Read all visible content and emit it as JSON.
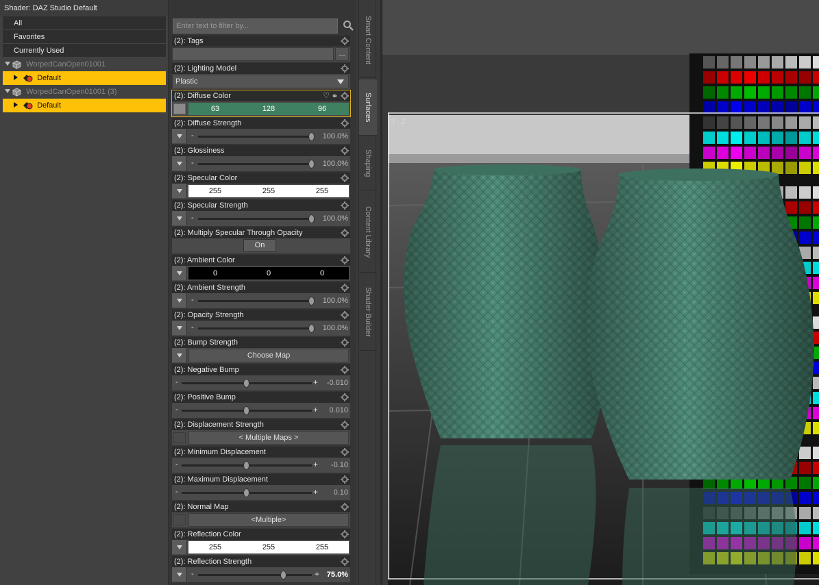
{
  "shader_panel": {
    "title": "Shader: DAZ Studio Default",
    "categories": [
      "All",
      "Favorites",
      "Currently Used"
    ],
    "tree": [
      {
        "label": "WorpedCanOpen01001",
        "child": "Default"
      },
      {
        "label": "WorpedCanOpen01001 (3)",
        "child": "Default"
      }
    ]
  },
  "filter": {
    "placeholder": "Enter text to filter by..."
  },
  "properties": {
    "tags": {
      "label": "(2): Tags",
      "button": "..."
    },
    "lighting_model": {
      "label": "(2): Lighting Model",
      "value": "Plastic"
    },
    "diffuse_color": {
      "label": "(2): Diffuse Color",
      "r": "63",
      "g": "128",
      "b": "96",
      "color": "#3f8060"
    },
    "diffuse_strength": {
      "label": "(2): Diffuse Strength",
      "value": "100.0%",
      "level": 1.0
    },
    "glossiness": {
      "label": "(2): Glossiness",
      "value": "100.0%",
      "level": 1.0
    },
    "specular_color": {
      "label": "(2): Specular Color",
      "r": "255",
      "g": "255",
      "b": "255",
      "color": "#ffffff"
    },
    "specular_strength": {
      "label": "(2): Specular Strength",
      "value": "100.0%",
      "level": 1.0
    },
    "multiply_specular": {
      "label": "(2): Multiply Specular Through Opacity",
      "value": "On"
    },
    "ambient_color": {
      "label": "(2): Ambient Color",
      "r": "0",
      "g": "0",
      "b": "0",
      "color": "#000000"
    },
    "ambient_strength": {
      "label": "(2): Ambient Strength",
      "value": "100.0%",
      "level": 1.0
    },
    "opacity_strength": {
      "label": "(2): Opacity Strength",
      "value": "100.0%",
      "level": 1.0
    },
    "bump_strength": {
      "label": "(2): Bump Strength",
      "value": "Choose Map"
    },
    "negative_bump": {
      "label": "(2): Negative Bump",
      "value": "-0.010",
      "level": 0.5
    },
    "positive_bump": {
      "label": "(2): Positive Bump",
      "value": "0.010",
      "level": 0.5
    },
    "displacement_strength": {
      "label": "(2): Displacement Strength",
      "value": "< Multiple Maps >"
    },
    "minimum_displacement": {
      "label": "(2): Minimum Displacement",
      "value": "-0.10",
      "level": 0.5
    },
    "maximum_displacement": {
      "label": "(2): Maximum Displacement",
      "value": "0.10",
      "level": 0.5
    },
    "normal_map": {
      "label": "(2): Normal Map",
      "value": "<Multiple>"
    },
    "reflection_color": {
      "label": "(2): Reflection Color",
      "r": "255",
      "g": "255",
      "b": "255",
      "color": "#ffffff"
    },
    "reflection_strength": {
      "label": "(2): Reflection Strength",
      "value": "75.0%",
      "level": 0.75
    }
  },
  "tabs": [
    "Smart Content",
    "Surfaces",
    "Shaping",
    "Content Library",
    "Shader Builder"
  ],
  "viewport": {
    "aspect_label": "3 : 2",
    "object_color": "#4f8c7a"
  }
}
